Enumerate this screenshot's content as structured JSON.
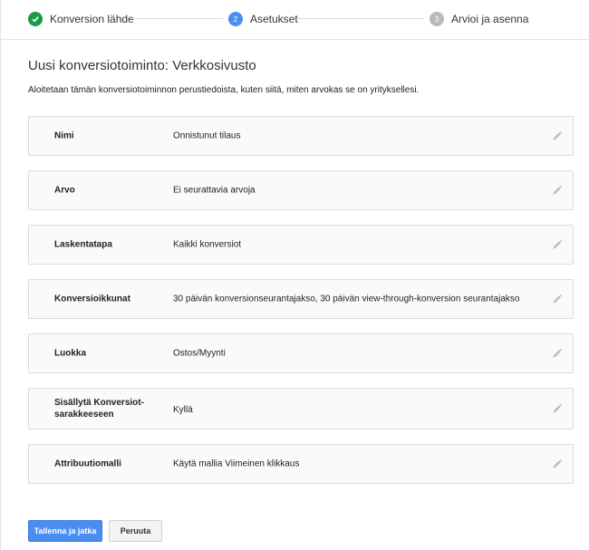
{
  "stepper": {
    "steps": [
      {
        "number": "",
        "label": "Konversion lähde",
        "state": "done",
        "icon": "check-icon"
      },
      {
        "number": "2",
        "label": "Asetukset",
        "state": "active"
      },
      {
        "number": "3",
        "label": "Arvioi ja asenna",
        "state": "pending"
      }
    ]
  },
  "header": {
    "title": "Uusi konversiotoiminto: Verkkosivusto",
    "description": "Aloitetaan tämän konversiotoiminnon perustiedoista, kuten siitä, miten arvokas se on yrityksellesi."
  },
  "settings": [
    {
      "label": "Nimi",
      "value": "Onnistunut tilaus"
    },
    {
      "label": "Arvo",
      "value": "Ei seurattavia arvoja"
    },
    {
      "label": "Laskentatapa",
      "value": "Kaikki konversiot"
    },
    {
      "label": "Konversioikkunat",
      "value": "30 päivän konversionseurantajakso, 30 päivän view-through-konversion seurantajakso"
    },
    {
      "label": "Luokka",
      "value": "Ostos/Myynti"
    },
    {
      "label": "Sisällytä Konversiot-sarakkeeseen",
      "value": "Kyllä"
    },
    {
      "label": "Attribuutiomalli",
      "value": "Käytä mallia Viimeinen klikkaus"
    }
  ],
  "actions": {
    "save_label": "Tallenna ja jatka",
    "cancel_label": "Peruuta"
  },
  "colors": {
    "accent": "#4a8ef2",
    "done": "#1a9a4b",
    "pending": "#b9b9b9"
  }
}
